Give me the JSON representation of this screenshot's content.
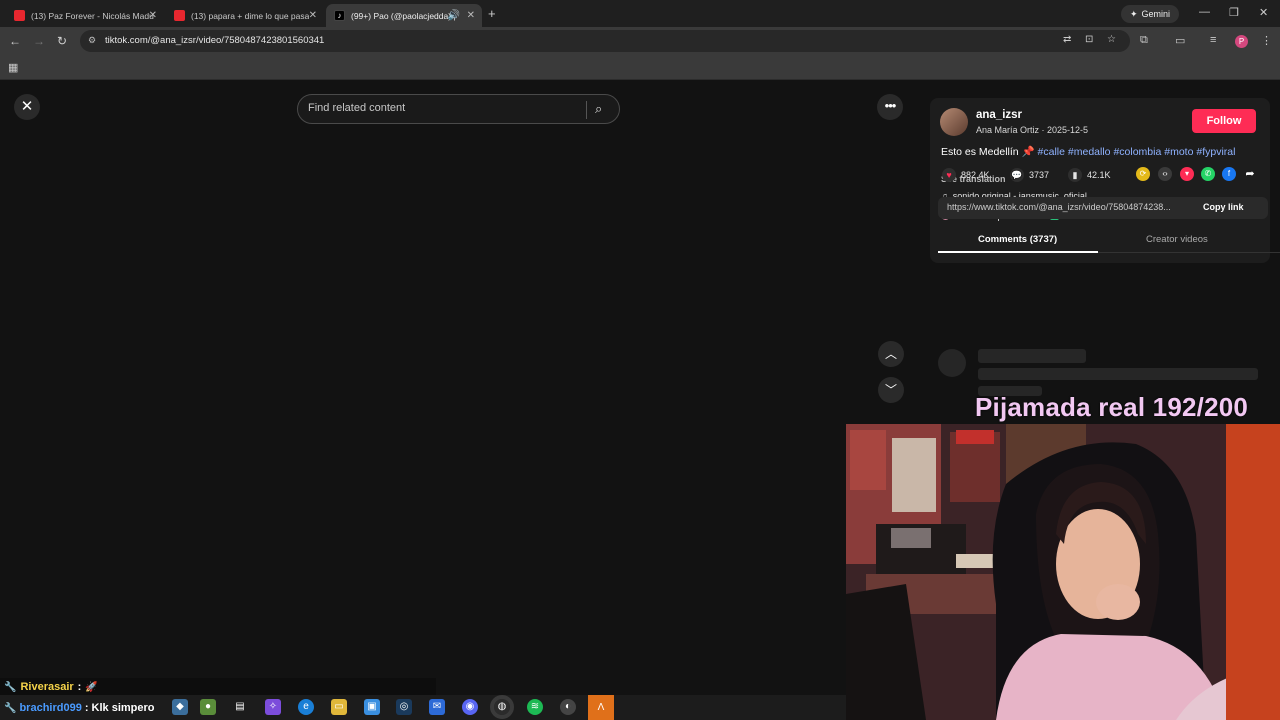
{
  "browser": {
    "tabs": [
      {
        "label": "(13) Paz Forever - Nicolás Madu",
        "color": "#e8272f"
      },
      {
        "label": "(13) papara + dime lo que pasa",
        "color": "#e8272f"
      },
      {
        "label": "(99+) Pao (@paolacjedda) |",
        "color": "#111111"
      }
    ],
    "gemini_label": "Gemini",
    "url": "tiktok.com/@ana_izsr/video/7580487423801560341"
  },
  "tiktok": {
    "search_placeholder": "Find related content",
    "author": {
      "username": "ana_izsr",
      "display_name": "Ana María Ortiz",
      "date": "2025-12-5"
    },
    "follow_label": "Follow",
    "caption_text": "Esto es Medellín 📌",
    "hashtags": [
      "#calle",
      "#medallo",
      "#colombia",
      "#moto",
      "#fypviral"
    ],
    "see_translation": "See translation",
    "sound": "sonido original - jansmusic_oficial",
    "reposted_by": "Anarella reposted",
    "location": "Medellín",
    "stats": {
      "likes": "882.4K",
      "comments": "3737",
      "saves": "42.1K"
    },
    "share_colors": [
      "#e3b91a",
      "#3a3a3a",
      "#fe2c55",
      "#25d366",
      "#1877f2",
      "#1d1d1d"
    ],
    "link_url": "https://www.tiktok.com/@ana_izsr/video/75804874238...",
    "copy_link_label": "Copy link",
    "tab_comments": "Comments (3737)",
    "tab_creator_videos": "Creator videos"
  },
  "stream": {
    "overlay_title": "Pijamada real 192/200",
    "chat": [
      {
        "user": "Riverasair",
        "message": ":"
      },
      {
        "user": "brachird099",
        "message": ": Klk simpero"
      }
    ],
    "colors": {
      "user1": "#f5d34a",
      "user2": "#4a9bff"
    }
  }
}
